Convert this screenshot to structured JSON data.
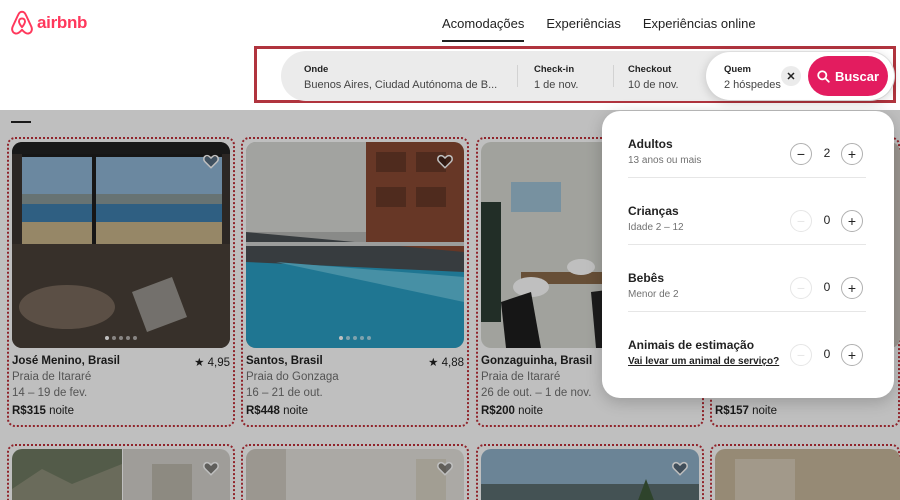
{
  "brand": {
    "name": "airbnb",
    "color": "#FF385C"
  },
  "nav": {
    "tabs": [
      {
        "label": "Acomodações",
        "active": true
      },
      {
        "label": "Experiências",
        "active": false
      },
      {
        "label": "Experiências online",
        "active": false
      }
    ]
  },
  "search": {
    "where_label": "Onde",
    "where_value": "Buenos Aires, Ciudad Autónoma de B...",
    "checkin_label": "Check-in",
    "checkin_value": "1 de nov.",
    "checkout_label": "Checkout",
    "checkout_value": "10 de nov.",
    "who_label": "Quem",
    "who_value": "2 hóspedes",
    "clear_icon": "close-icon",
    "button_label": "Buscar",
    "button_color": "#E31C5F"
  },
  "listings": [
    {
      "title": "José Menino, Brasil",
      "rating": "★ 4,95",
      "area": "Praia de Itararé",
      "dates": "14 – 19 de fev.",
      "price": "R$315",
      "unit": " noite"
    },
    {
      "title": "Santos, Brasil",
      "rating": "★ 4,88",
      "area": "Praia do Gonzaga",
      "dates": "16 – 21 de out.",
      "price": "R$448",
      "unit": " noite"
    },
    {
      "title": "Gonzaguinha, Brasil",
      "rating": "",
      "area": "Praia de Itararé",
      "dates": "26 de out. – 1 de nov.",
      "price": "R$200",
      "unit": " noite"
    },
    {
      "title": "",
      "rating": "",
      "area": "",
      "dates": "",
      "price": "R$157",
      "unit": " noite"
    }
  ],
  "guests": {
    "rows": [
      {
        "title": "Adultos",
        "sub": "13 anos ou mais",
        "value": "2",
        "minus_enabled": true
      },
      {
        "title": "Crianças",
        "sub": "Idade 2 – 12",
        "value": "0",
        "minus_enabled": false
      },
      {
        "title": "Bebês",
        "sub": "Menor de 2",
        "value": "0",
        "minus_enabled": false
      },
      {
        "title": "Animais de estimação",
        "sub": "Vai levar um animal de serviço?",
        "value": "0",
        "minus_enabled": false
      }
    ],
    "minus_symbol": "−",
    "plus_symbol": "+"
  }
}
